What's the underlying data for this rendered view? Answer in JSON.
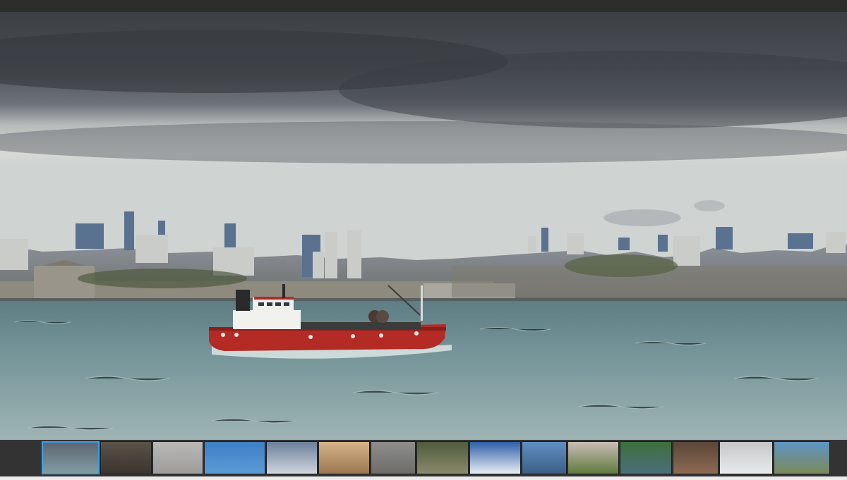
{
  "viewer": {
    "main_image": "bosphorus-red-tanker-istanbul-skyline",
    "colors": {
      "frame": "#2d2d2d",
      "selected_border": "#3aa0e8",
      "sky_dark": "#3f4348",
      "sky_light": "#d9dcd8",
      "water": "#6f8e93",
      "boat_hull": "#b42a25"
    }
  },
  "filmstrip": {
    "selected_index": 0,
    "thumbnails": [
      {
        "name": "thumb-bosphorus-boat",
        "top": "#5d6670",
        "bottom": "#7f9ca3"
      },
      {
        "name": "thumb-wooden-pier",
        "top": "#5a5248",
        "bottom": "#3b3530"
      },
      {
        "name": "thumb-misty-grey",
        "top": "#b9b8b6",
        "bottom": "#9e9d9b"
      },
      {
        "name": "thumb-blue-ice",
        "top": "#3f7fc4",
        "bottom": "#5b9ad6"
      },
      {
        "name": "thumb-snow-mountains",
        "top": "#6c7f99",
        "bottom": "#cfd6de"
      },
      {
        "name": "thumb-sunset-beach",
        "top": "#d8b48a",
        "bottom": "#9b7650"
      },
      {
        "name": "thumb-foggy-forest",
        "top": "#8d8d8b",
        "bottom": "#6d6c69"
      },
      {
        "name": "thumb-bird-branches",
        "top": "#4f5b3b",
        "bottom": "#8a8a6b"
      },
      {
        "name": "thumb-above-clouds",
        "top": "#2d5fa8",
        "bottom": "#e9eef4"
      },
      {
        "name": "thumb-sea-rock",
        "top": "#5f8fc2",
        "bottom": "#3c5f86"
      },
      {
        "name": "thumb-house-field",
        "top": "#c9bdb7",
        "bottom": "#5f7a3c"
      },
      {
        "name": "thumb-lake-boat",
        "top": "#3e6f3a",
        "bottom": "#4b6e7d"
      },
      {
        "name": "thumb-red-cottage",
        "top": "#5a4638",
        "bottom": "#8c6a52"
      },
      {
        "name": "thumb-snowy-road",
        "top": "#c4c6c8",
        "bottom": "#e8eaec"
      },
      {
        "name": "thumb-coast-cliff",
        "top": "#5f95c4",
        "bottom": "#7b8a5a"
      }
    ]
  }
}
